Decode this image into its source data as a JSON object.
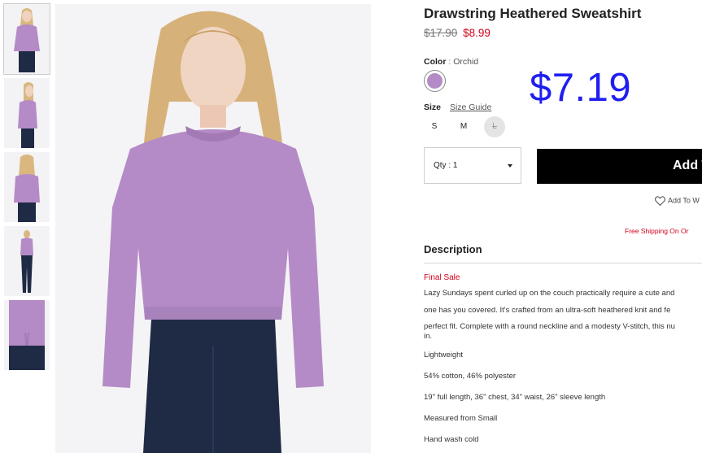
{
  "thumbnails": [
    {
      "view": "front"
    },
    {
      "view": "side"
    },
    {
      "view": "back"
    },
    {
      "view": "full-length"
    },
    {
      "view": "detail"
    }
  ],
  "product": {
    "title": "Drawstring Heathered Sweatshirt",
    "price_original": "$17.90",
    "price_sale": "$8.99",
    "promo_price": "$7.19",
    "color_label": "Color",
    "color_separator": ":",
    "color_value": "Orchid",
    "swatch_color": "#b48bc6",
    "size_label": "Size",
    "size_guide_label": "Size Guide",
    "sizes": [
      {
        "label": "S",
        "available": true
      },
      {
        "label": "M",
        "available": true
      },
      {
        "label": "L",
        "available": false
      }
    ],
    "quantity_label": "Qty : 1",
    "add_button_label": "Add To",
    "wishlist_label": "Add To W",
    "shipping_note": "Free Shipping On Or"
  },
  "description": {
    "heading": "Description",
    "final_sale": "Final Sale",
    "body_lines": [
      "Lazy Sundays spent curled up on the couch practically require a cute and",
      "one has you covered. It's crafted from an ultra-soft heathered knit and fe",
      "perfect fit. Complete with a round neckline and a modesty V-stitch, this nu",
      "in."
    ],
    "features": [
      "Lightweight",
      "54% cotton, 46% polyester",
      "19\" full length, 36\" chest, 34\" waist, 26\" sleeve length",
      "Measured from Small",
      "Hand wash cold"
    ]
  },
  "colors": {
    "sale_red": "#d0021b",
    "promo_blue": "#1f1ff0",
    "button_black": "#000000",
    "sweatshirt_lilac": "#b48bc6"
  },
  "icons": {
    "wishlist": "heart-outline-icon",
    "quantity": "caret-down-icon"
  }
}
